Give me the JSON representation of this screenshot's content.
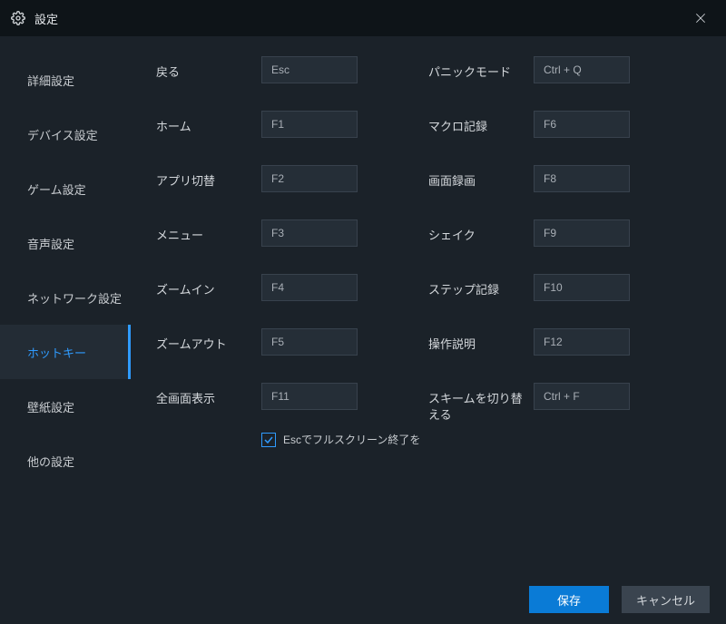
{
  "titlebar": {
    "title": "設定"
  },
  "sidebar": {
    "items": [
      {
        "label": "詳細設定"
      },
      {
        "label": "デバイス設定"
      },
      {
        "label": "ゲーム設定"
      },
      {
        "label": "音声設定"
      },
      {
        "label": "ネットワーク設定"
      },
      {
        "label": "ホットキー"
      },
      {
        "label": "壁紙設定"
      },
      {
        "label": "他の設定"
      }
    ]
  },
  "hotkeys": {
    "left": [
      {
        "label": "戻る",
        "value": "Esc"
      },
      {
        "label": "ホーム",
        "value": "F1"
      },
      {
        "label": "アプリ切替",
        "value": "F2"
      },
      {
        "label": "メニュー",
        "value": "F3"
      },
      {
        "label": "ズームイン",
        "value": "F4"
      },
      {
        "label": "ズームアウト",
        "value": "F5"
      },
      {
        "label": "全画面表示",
        "value": "F11"
      }
    ],
    "right": [
      {
        "label": "パニックモード",
        "value": "Ctrl + Q"
      },
      {
        "label": "マクロ記録",
        "value": "F6"
      },
      {
        "label": "画面録画",
        "value": "F8"
      },
      {
        "label": "シェイク",
        "value": "F9"
      },
      {
        "label": "ステップ記録",
        "value": "F10"
      },
      {
        "label": "操作説明",
        "value": "F12"
      },
      {
        "label": "スキームを切り替える",
        "value": "Ctrl + F"
      }
    ],
    "esc_fullscreen_label": "Escでフルスクリーン終了を"
  },
  "footer": {
    "save": "保存",
    "cancel": "キャンセル"
  }
}
